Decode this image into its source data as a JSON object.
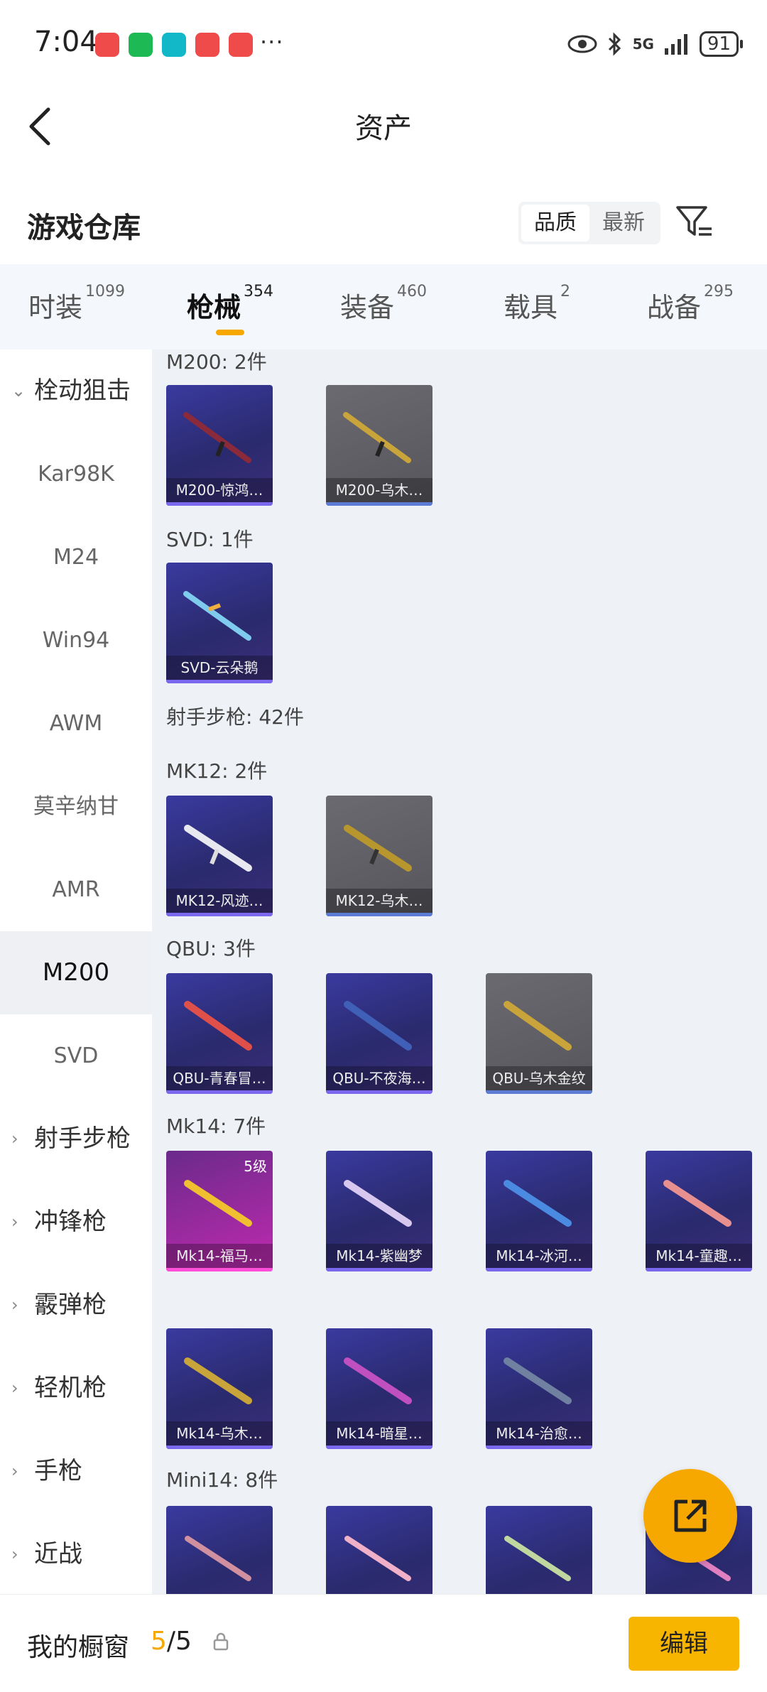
{
  "status_bar": {
    "time": "7:04",
    "more": "···",
    "network": "5G",
    "battery": "91",
    "app_icons": [
      {
        "name": "shop-icon",
        "color": "#f04b4b"
      },
      {
        "name": "wechat-icon",
        "color": "#1db954"
      },
      {
        "name": "shield-icon",
        "color": "#12b7c8"
      },
      {
        "name": "photo-icon",
        "color": "#f04b4b"
      },
      {
        "name": "bag-icon",
        "color": "#f04b4b"
      }
    ]
  },
  "header": {
    "title": "资产"
  },
  "warehouse": {
    "title": "游戏仓库",
    "sort": [
      "品质",
      "最新"
    ]
  },
  "tabs": [
    {
      "label": "时装",
      "count": "1099"
    },
    {
      "label": "枪械",
      "count": "354",
      "active": true
    },
    {
      "label": "装备",
      "count": "460"
    },
    {
      "label": "载具",
      "count": "2"
    },
    {
      "label": "战备",
      "count": "295"
    }
  ],
  "sidebar": {
    "items": [
      {
        "label": "栓动狙击",
        "type": "cat",
        "expanded": true
      },
      {
        "label": "Kar98K",
        "type": "sub"
      },
      {
        "label": "M24",
        "type": "sub"
      },
      {
        "label": "Win94",
        "type": "sub"
      },
      {
        "label": "AWM",
        "type": "sub"
      },
      {
        "label": "莫辛纳甘",
        "type": "sub"
      },
      {
        "label": "AMR",
        "type": "sub"
      },
      {
        "label": "M200",
        "type": "sub",
        "selected": true
      },
      {
        "label": "SVD",
        "type": "sub"
      },
      {
        "label": "射手步枪",
        "type": "cat"
      },
      {
        "label": "冲锋枪",
        "type": "cat"
      },
      {
        "label": "霰弹枪",
        "type": "cat"
      },
      {
        "label": "轻机枪",
        "type": "cat"
      },
      {
        "label": "手枪",
        "type": "cat"
      },
      {
        "label": "近战",
        "type": "cat"
      }
    ]
  },
  "groups": {
    "m200": "M200: 2件",
    "svd": "SVD: 1件",
    "marksman": "射手步枪: 42件",
    "mk12": "MK12: 2件",
    "qbu": "QBU: 3件",
    "mk14": "Mk14: 7件",
    "mini14": "Mini14: 8件"
  },
  "items": {
    "m200_1": "M200-惊鸿…",
    "m200_2": "M200-乌木…",
    "svd_1": "SVD-云朵鹅",
    "mk12_1": "MK12-风迹…",
    "mk12_2": "MK12-乌木…",
    "qbu_1": "QBU-青春冒…",
    "qbu_2": "QBU-不夜海…",
    "qbu_3": "QBU-乌木金纹",
    "mk14_1": "Mk14-福马…",
    "mk14_1_level": "5级",
    "mk14_2": "Mk14-紫幽梦",
    "mk14_3": "Mk14-冰河…",
    "mk14_4": "Mk14-童趣…",
    "mk14_5": "Mk14-乌木…",
    "mk14_6": "Mk14-暗星…",
    "mk14_7": "Mk14-治愈…"
  },
  "bottom": {
    "label": "我的橱窗",
    "count_current": "5",
    "count_total": "/5",
    "edit": "编辑"
  },
  "colors": {
    "accent": "#f7a800",
    "card_purple": "#2a2a6e",
    "card_gray": "#55555b",
    "card_pink": "#c02ab0"
  }
}
